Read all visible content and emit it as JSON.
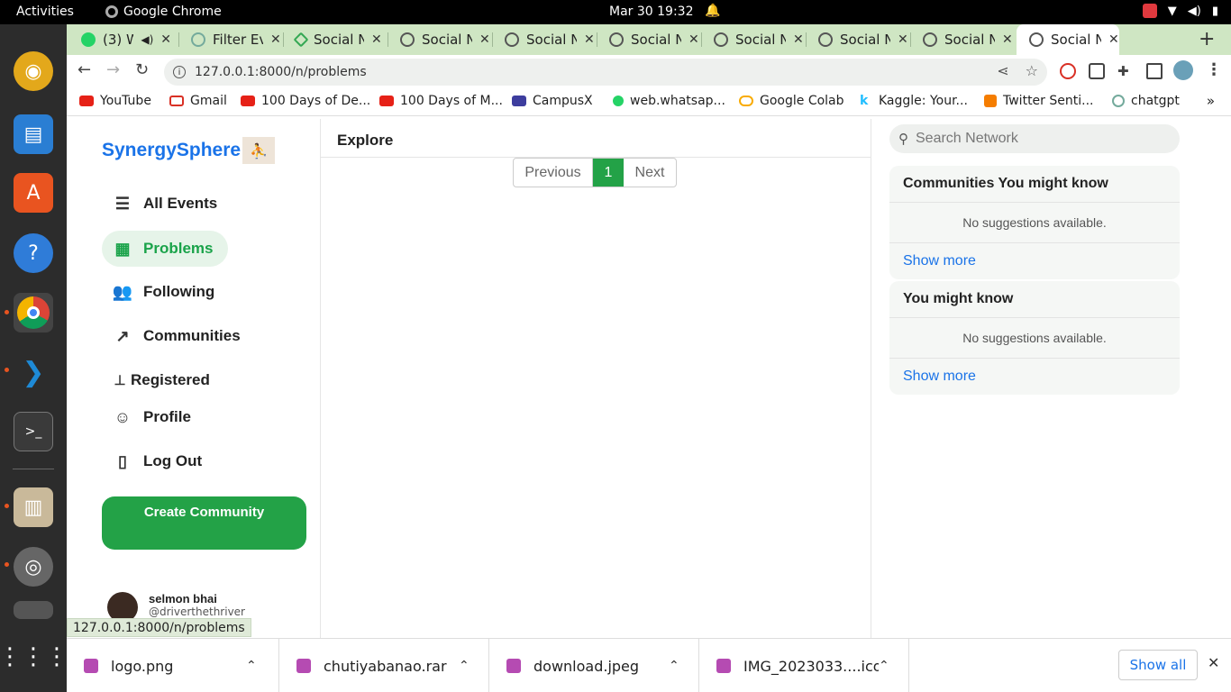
{
  "os": {
    "activities": "Activities",
    "app_name": "Google Chrome",
    "clock": "Mar 30  19:32"
  },
  "browser": {
    "tabs": [
      {
        "title": "(3) W",
        "icon": "whatsapp-icon"
      },
      {
        "title": "Filter Ev",
        "icon": "chatgpt-icon"
      },
      {
        "title": "Social N",
        "icon": "network-icon"
      },
      {
        "title": "Social N",
        "icon": "globe-icon"
      },
      {
        "title": "Social N",
        "icon": "globe-icon"
      },
      {
        "title": "Social N",
        "icon": "globe-icon"
      },
      {
        "title": "Social N",
        "icon": "globe-icon"
      },
      {
        "title": "Social N",
        "icon": "globe-icon"
      },
      {
        "title": "Social N",
        "icon": "globe-icon"
      },
      {
        "title": "Social N",
        "icon": "globe-icon",
        "active": true
      }
    ],
    "url": "127.0.0.1:8000/n/problems",
    "bookmarks": [
      {
        "label": "YouTube",
        "color": "#e62117"
      },
      {
        "label": "Gmail",
        "color": "#d93025"
      },
      {
        "label": "100 Days of De...",
        "color": "#e62117"
      },
      {
        "label": "100 Days of M...",
        "color": "#e62117"
      },
      {
        "label": "CampusX",
        "color": "#3d3d9e"
      },
      {
        "label": "web.whatsap...",
        "color": "#25d366"
      },
      {
        "label": "Google Colab",
        "color": "#f9ab00"
      },
      {
        "label": "Kaggle: Your...",
        "color": "#20beff"
      },
      {
        "label": "Twitter Senti...",
        "color": "#f57d00"
      },
      {
        "label": "chatgpt",
        "color": "#74aa9c"
      }
    ],
    "status_url": "127.0.0.1:8000/n/problems"
  },
  "app": {
    "brand": "SynergySphere",
    "nav": [
      {
        "label": "All Events",
        "icon": "list-icon"
      },
      {
        "label": "Problems",
        "icon": "grid-icon",
        "active": true
      },
      {
        "label": "Following",
        "icon": "users-icon"
      },
      {
        "label": "Communities",
        "icon": "trending-icon"
      },
      {
        "label": "Registered",
        "icon": "pin-icon"
      },
      {
        "label": "Profile",
        "icon": "user-icon"
      },
      {
        "label": "Log Out",
        "icon": "door-icon"
      }
    ],
    "create_button": "Create Community",
    "user": {
      "name": "selmon bhai",
      "handle": "@driverthethriver"
    },
    "section_title": "Explore",
    "pagination": {
      "previous": "Previous",
      "current": "1",
      "next": "Next"
    },
    "search_placeholder": "Search Network",
    "communities_card": {
      "title": "Communities You might know",
      "empty": "No suggestions available.",
      "more": "Show more"
    },
    "people_card": {
      "title": "You might know",
      "empty": "No suggestions available.",
      "more": "Show more"
    }
  },
  "downloads": {
    "items": [
      "logo.png",
      "chutiyabanao.rar",
      "download.jpeg",
      "IMG_2023033....ico"
    ],
    "show_all": "Show all"
  }
}
